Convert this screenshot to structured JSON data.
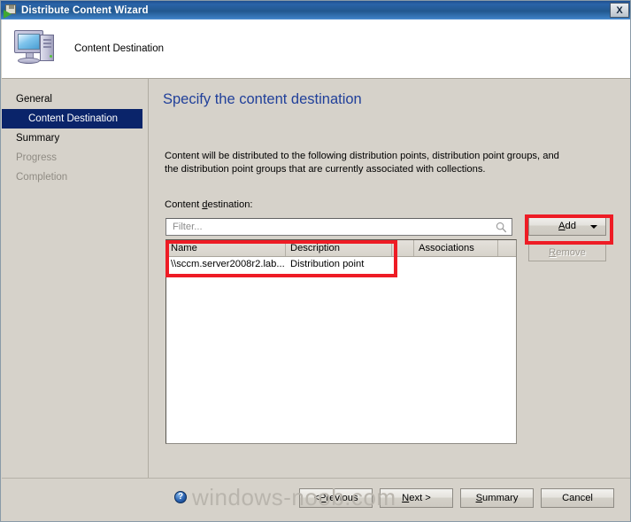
{
  "window": {
    "title": "Distribute Content Wizard",
    "title_icon": "distribute-content-icon",
    "close_label": "X"
  },
  "header": {
    "title": "Content Destination",
    "icon": "computer-icon"
  },
  "sidebar": {
    "items": [
      {
        "label": "General",
        "state": "normal",
        "indent": false
      },
      {
        "label": "Content Destination",
        "state": "selected",
        "indent": true
      },
      {
        "label": "Summary",
        "state": "normal",
        "indent": false
      },
      {
        "label": "Progress",
        "state": "disabled",
        "indent": false
      },
      {
        "label": "Completion",
        "state": "disabled",
        "indent": false
      }
    ]
  },
  "content": {
    "heading": "Specify the content destination",
    "intro": "Content will be distributed to the following distribution points, distribution point groups, and the distribution point groups that are currently associated with collections.",
    "destination_label": "Content destination:",
    "filter": {
      "placeholder": "Filter...",
      "value": "",
      "icon": "search-icon"
    },
    "buttons": {
      "add": "Add",
      "add_dropdown_icon": "chevron-down-icon",
      "remove": "Remove",
      "remove_enabled": false
    },
    "table": {
      "columns": [
        "Name",
        "Description",
        "",
        "Associations",
        ""
      ],
      "rows": [
        {
          "name": "\\\\sccm.server2008r2.lab...",
          "description": "Distribution point",
          "extra": "",
          "associations": ""
        }
      ]
    }
  },
  "footer": {
    "help_icon": "help-icon",
    "help_label": "?",
    "buttons": {
      "previous": "< Previous",
      "next": "Next >",
      "summary": "Summary",
      "cancel": "Cancel"
    }
  },
  "watermark": "windows-noob.com",
  "colors": {
    "titlebar_blue": "#2a63a8",
    "heading_blue": "#21409a",
    "selection_blue": "#0a246a",
    "dialog_face": "#d6d2ca",
    "annotation_red": "#ee1c25"
  }
}
